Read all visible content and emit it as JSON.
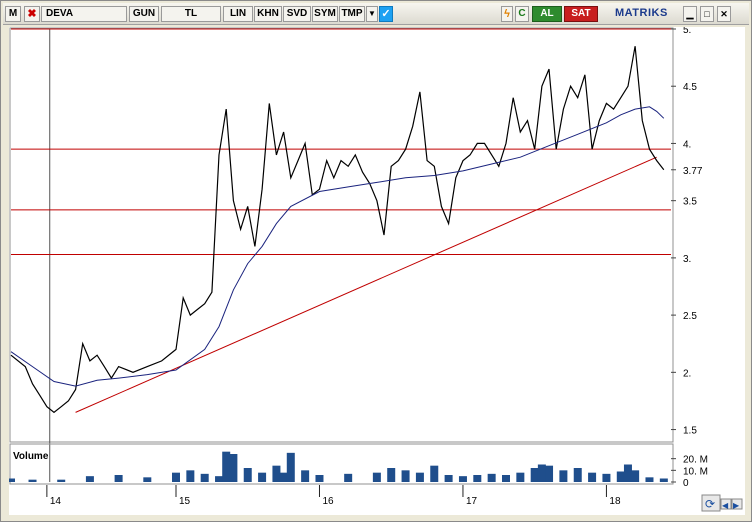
{
  "toolbar": {
    "app_icon": "M",
    "symbol": "DEVA",
    "buttons": [
      "GUN",
      "TL",
      "LIN",
      "KHN",
      "SVD",
      "SYM",
      "TMP"
    ],
    "dropdown_icon": "dropdown-arrow-icon",
    "social_icon": "twitter-icon",
    "flash_icon": "lightning-icon",
    "refresh_label": "C",
    "buy_label": "AL",
    "sell_label": "SAT",
    "brand": "MATRIKS",
    "window_controls": [
      "minimize-icon",
      "maximize-icon",
      "close-icon"
    ]
  },
  "colors": {
    "price": "#000000",
    "moving_average": "#1a237e",
    "levels": "#c00000",
    "trendline": "#c00000",
    "volume": "#1f4e8c",
    "grid": "#c0c0c0"
  },
  "chart_data": {
    "type": "line",
    "title": "",
    "xlabel": "",
    "ylabel": "",
    "y_ticks": [
      "1.5",
      "2.",
      "2.5",
      "3.",
      "3.5",
      "3.77",
      "4.",
      "4.5",
      "5."
    ],
    "ylim": [
      1.4,
      5.0
    ],
    "x_ticks": [
      "14",
      "15",
      "16",
      "17",
      "18"
    ],
    "x_tick_positions": [
      2014.1,
      2015.0,
      2016.0,
      2017.0,
      2018.0
    ],
    "x_range": [
      2013.85,
      2018.45
    ],
    "last_value": "3.77",
    "horizontal_levels": [
      5.0,
      3.95,
      3.42,
      3.03
    ],
    "trendline": {
      "x": [
        2014.3,
        2018.35
      ],
      "y": [
        1.65,
        3.88
      ]
    },
    "series": [
      {
        "x": [
          2013.85,
          2013.95,
          2014.0,
          2014.05,
          2014.1,
          2014.15,
          2014.2,
          2014.25,
          2014.3,
          2014.35,
          2014.4,
          2014.45,
          2014.5,
          2014.55,
          2014.6,
          2014.7,
          2014.8,
          2014.9,
          2015.0,
          2015.05,
          2015.1,
          2015.15,
          2015.2,
          2015.25,
          2015.3,
          2015.35,
          2015.4,
          2015.45,
          2015.5,
          2015.55,
          2015.6,
          2015.65,
          2015.7,
          2015.75,
          2015.8,
          2015.85,
          2015.9,
          2015.95,
          2016.0,
          2016.05,
          2016.1,
          2016.15,
          2016.2,
          2016.25,
          2016.3,
          2016.35,
          2016.4,
          2016.45,
          2016.5,
          2016.55,
          2016.6,
          2016.65,
          2016.7,
          2016.75,
          2016.8,
          2016.85,
          2016.9,
          2016.95,
          2017.0,
          2017.05,
          2017.1,
          2017.15,
          2017.2,
          2017.25,
          2017.3,
          2017.35,
          2017.4,
          2017.45,
          2017.5,
          2017.55,
          2017.6,
          2017.65,
          2017.7,
          2017.75,
          2017.8,
          2017.85,
          2017.9,
          2017.95,
          2018.0,
          2018.05,
          2018.1,
          2018.15,
          2018.2,
          2018.25,
          2018.3,
          2018.35,
          2018.4
        ],
        "y": [
          2.15,
          2.05,
          1.9,
          1.8,
          1.7,
          1.65,
          1.7,
          1.75,
          1.85,
          2.25,
          2.1,
          2.15,
          2.05,
          1.95,
          2.05,
          2.0,
          2.05,
          2.1,
          2.2,
          2.65,
          2.5,
          2.55,
          2.6,
          2.7,
          3.9,
          4.3,
          3.5,
          3.25,
          3.45,
          3.1,
          3.6,
          4.35,
          3.9,
          4.1,
          3.7,
          3.85,
          4.0,
          3.55,
          3.6,
          3.85,
          3.7,
          3.85,
          3.8,
          3.9,
          3.75,
          3.65,
          3.5,
          3.2,
          3.8,
          3.85,
          3.95,
          4.15,
          4.45,
          3.85,
          3.8,
          3.45,
          3.3,
          3.7,
          3.85,
          3.9,
          4.0,
          4.0,
          3.9,
          3.8,
          4.0,
          4.4,
          4.1,
          4.2,
          3.95,
          4.5,
          4.65,
          3.95,
          4.3,
          4.5,
          4.4,
          4.6,
          3.95,
          4.2,
          4.35,
          4.3,
          4.4,
          4.5,
          4.85,
          4.2,
          3.95,
          3.85,
          3.77
        ]
      },
      {
        "x": [
          2013.85,
          2014.0,
          2014.15,
          2014.3,
          2014.45,
          2014.6,
          2014.8,
          2015.0,
          2015.2,
          2015.3,
          2015.4,
          2015.5,
          2015.6,
          2015.7,
          2015.8,
          2016.0,
          2016.2,
          2016.4,
          2016.6,
          2016.8,
          2017.0,
          2017.2,
          2017.4,
          2017.6,
          2017.8,
          2018.0,
          2018.1,
          2018.2,
          2018.3,
          2018.35,
          2018.4
        ],
        "y": [
          2.18,
          2.05,
          1.92,
          1.88,
          1.93,
          1.95,
          1.98,
          2.02,
          2.2,
          2.4,
          2.72,
          2.95,
          3.1,
          3.3,
          3.45,
          3.58,
          3.62,
          3.66,
          3.7,
          3.72,
          3.76,
          3.82,
          3.88,
          3.98,
          4.08,
          4.18,
          4.25,
          4.3,
          4.32,
          4.28,
          4.22
        ]
      }
    ],
    "volume": {
      "label": "Volume",
      "y_ticks": [
        "20. M",
        "10. M",
        "0"
      ],
      "ylim": [
        0,
        30
      ],
      "x": [
        2013.85,
        2014.0,
        2014.2,
        2014.4,
        2014.6,
        2014.8,
        2015.0,
        2015.1,
        2015.2,
        2015.3,
        2015.35,
        2015.4,
        2015.5,
        2015.6,
        2015.7,
        2015.75,
        2015.8,
        2015.9,
        2016.0,
        2016.2,
        2016.4,
        2016.5,
        2016.6,
        2016.7,
        2016.8,
        2016.9,
        2017.0,
        2017.1,
        2017.2,
        2017.3,
        2017.4,
        2017.5,
        2017.55,
        2017.6,
        2017.7,
        2017.8,
        2017.9,
        2018.0,
        2018.1,
        2018.15,
        2018.2,
        2018.3,
        2018.4
      ],
      "values": [
        3,
        2,
        2,
        5,
        6,
        4,
        8,
        10,
        7,
        5,
        26,
        24,
        12,
        8,
        14,
        8,
        25,
        10,
        6,
        7,
        8,
        12,
        10,
        8,
        14,
        6,
        5,
        6,
        7,
        6,
        8,
        12,
        15,
        14,
        10,
        12,
        8,
        7,
        9,
        15,
        10,
        4,
        3
      ]
    }
  }
}
